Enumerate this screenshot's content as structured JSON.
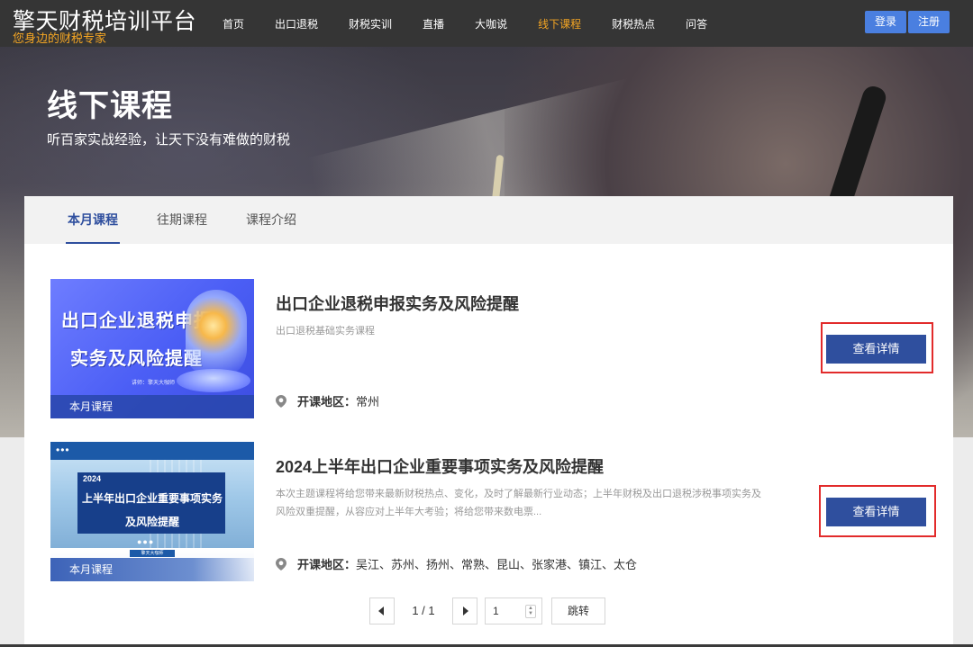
{
  "brand": {
    "title": "擎天财税培训平台",
    "subtitle": "您身边的财税专家"
  },
  "nav": {
    "items": [
      {
        "label": "首页"
      },
      {
        "label": "出口退税"
      },
      {
        "label": "财税实训"
      },
      {
        "label": "直播"
      },
      {
        "label": "大咖说"
      },
      {
        "label": "线下课程",
        "active": true
      },
      {
        "label": "财税热点"
      },
      {
        "label": "问答"
      }
    ],
    "login": "登录",
    "register": "注册"
  },
  "hero": {
    "title": "线下课程",
    "subtitle": "听百家实战经验，让天下没有难做的财税"
  },
  "tabs": [
    {
      "label": "本月课程",
      "active": true
    },
    {
      "label": "往期课程"
    },
    {
      "label": "课程介绍"
    }
  ],
  "courses": [
    {
      "title": "出口企业退税申报实务及风险提醒",
      "desc": "出口退税基础实务课程",
      "region_label": "开课地区：",
      "region": "常州",
      "button": "查看详情",
      "thumb": {
        "line1": "出口企业退税申报",
        "line2": "实务及风险提醒",
        "small": "讲师：擎天大咖师",
        "badge": "本月课程"
      }
    },
    {
      "title": "2024上半年出口企业重要事项实务及风险提醒",
      "desc": "本次主题课程将给您带来最新财税热点、变化，及时了解最新行业动态；上半年财税及出口退税涉税事项实务及风险双重提醒，从容应对上半年大考验；将给您带来数电票...",
      "region_label": "开课地区：",
      "region": "吴江、苏州、扬州、常熟、昆山、张家港、镇江、太仓",
      "button": "查看详情",
      "thumb": {
        "dots": "•••",
        "year": "2024",
        "line1": "上半年出口企业重要事项实务",
        "line2": "及风险提醒",
        "pager": "●●●",
        "minibar": "擎天大咖师",
        "badge": "本月课程"
      }
    }
  ],
  "pagination": {
    "page_text": "1 / 1",
    "input_value": "1",
    "jump": "跳转"
  },
  "colors": {
    "accent": "#2f4f9e",
    "nav_active": "#f5a623",
    "highlight": "#e22b2b",
    "auth_btn": "#4a7fe0"
  }
}
